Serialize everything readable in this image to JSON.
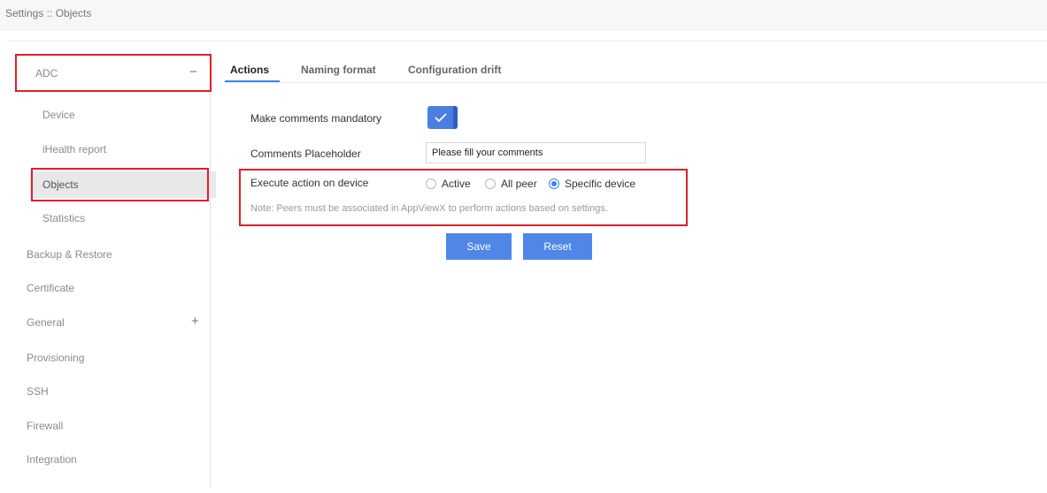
{
  "breadcrumb": "Settings :: Objects",
  "sidebar": {
    "adc": {
      "label": "ADC",
      "toggle": "−"
    },
    "sub_items": [
      "Device",
      "iHealth report",
      "Objects",
      "Statistics"
    ],
    "items": [
      {
        "label": "Backup & Restore"
      },
      {
        "label": "Certificate"
      },
      {
        "label": "General",
        "toggle": "+"
      },
      {
        "label": "Provisioning"
      },
      {
        "label": "SSH"
      },
      {
        "label": "Firewall"
      },
      {
        "label": "Integration"
      }
    ],
    "active": "Objects"
  },
  "tabs": [
    {
      "label": "Actions",
      "active": true
    },
    {
      "label": "Naming format",
      "active": false
    },
    {
      "label": "Configuration drift",
      "active": false
    }
  ],
  "form": {
    "mandatory_label": "Make comments mandatory",
    "mandatory_on": true,
    "placeholder_label": "Comments Placeholder",
    "placeholder_value": "Please fill your comments",
    "execute_label": "Execute action on device",
    "radio_options": [
      {
        "label": "Active",
        "selected": false
      },
      {
        "label": "All peer",
        "selected": false
      },
      {
        "label": "Specific device",
        "selected": true
      }
    ],
    "note": "Note: Peers must be associated in AppViewX to perform actions based on settings.",
    "save_label": "Save",
    "reset_label": "Reset"
  },
  "colors": {
    "accent": "#3b82f6",
    "button": "#4f86e8",
    "highlight": "#e0202a"
  }
}
